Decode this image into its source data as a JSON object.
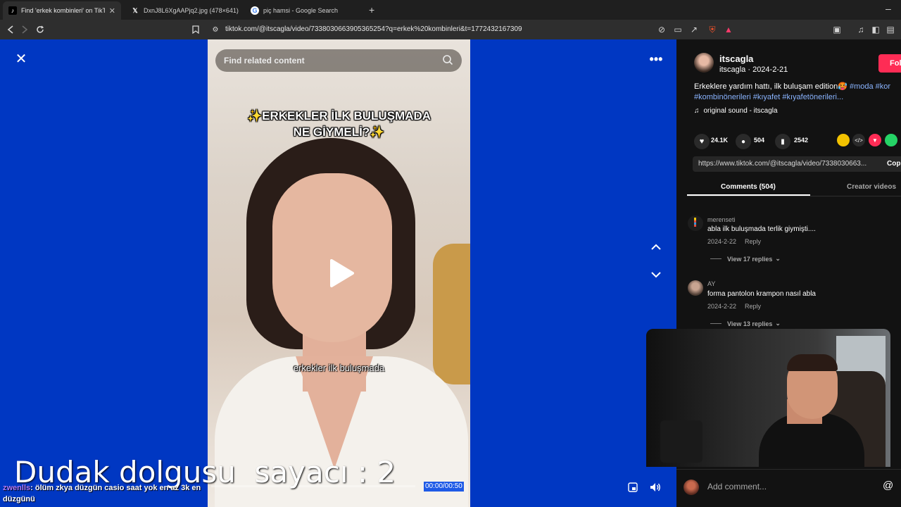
{
  "browser": {
    "tabs": [
      {
        "label": "Find 'erkek kombinleri' on TikTok",
        "icon": "tiktok-icon",
        "close": "✕"
      },
      {
        "label": "DxnJ8L6XgAAPjq2.jpg (478×641)",
        "icon": "x-icon"
      },
      {
        "label": "piç hamsi - Google Search",
        "icon": "google-icon"
      }
    ],
    "new_tab": "+",
    "url": "tiktok.com/@itscagla/video/7338030663905365254?q=erkek%20kombinleri&t=1772432167309"
  },
  "video": {
    "search_placeholder": "Find related content",
    "title_line1": "✨ERKEKLER İLK BULUŞMADA",
    "title_line2": "NE GİYMELİ?✨",
    "caption": "erkekler ilk buluşmada",
    "time": "00:00/00:50",
    "progress": 0
  },
  "overlay": {
    "counter_text": "Dudak dolgusu  sayacı : 2",
    "chat_user": "zwenlls",
    "chat_message": ": ölüm zkya düzgün casio saat yok en az 3k en",
    "chat_message_cont": "düzgünü"
  },
  "panel": {
    "username": "itscagla",
    "subline": "itscagla · 2024-2-21",
    "follow_label": "Fol",
    "description_plain": "Erkeklere yardım hattı, ilk buluşam edition🥵 ",
    "description_tags_line1": "#moda #kor",
    "description_tags_line2": "#kombinönerileri #kıyafet #kıyafetönerileri...",
    "sound": "original sound - itscagla",
    "likes": "24.1K",
    "comments_count": "504",
    "saves": "2542",
    "link": "https://www.tiktok.com/@itscagla/video/7338030663...",
    "copy_label": "Cop",
    "tab_comments": "Comments (504)",
    "tab_creator": "Creator videos",
    "comments": [
      {
        "user": "merenseti",
        "text": "abla ilk buluşmada terlik giymişti....",
        "date": "2024-2-22",
        "reply": "Reply",
        "view_replies": "View 17 replies"
      },
      {
        "user": "AY",
        "text": "forma pantolon krampon nasıl abla",
        "date": "2024-2-22",
        "reply": "Reply",
        "view_replies": "View 13 replies"
      }
    ],
    "add_comment_placeholder": "Add comment...",
    "at_symbol": "@"
  },
  "colors": {
    "background": "#0037c2",
    "accent": "#fe2c55",
    "hashtag": "#8ab4ff"
  }
}
